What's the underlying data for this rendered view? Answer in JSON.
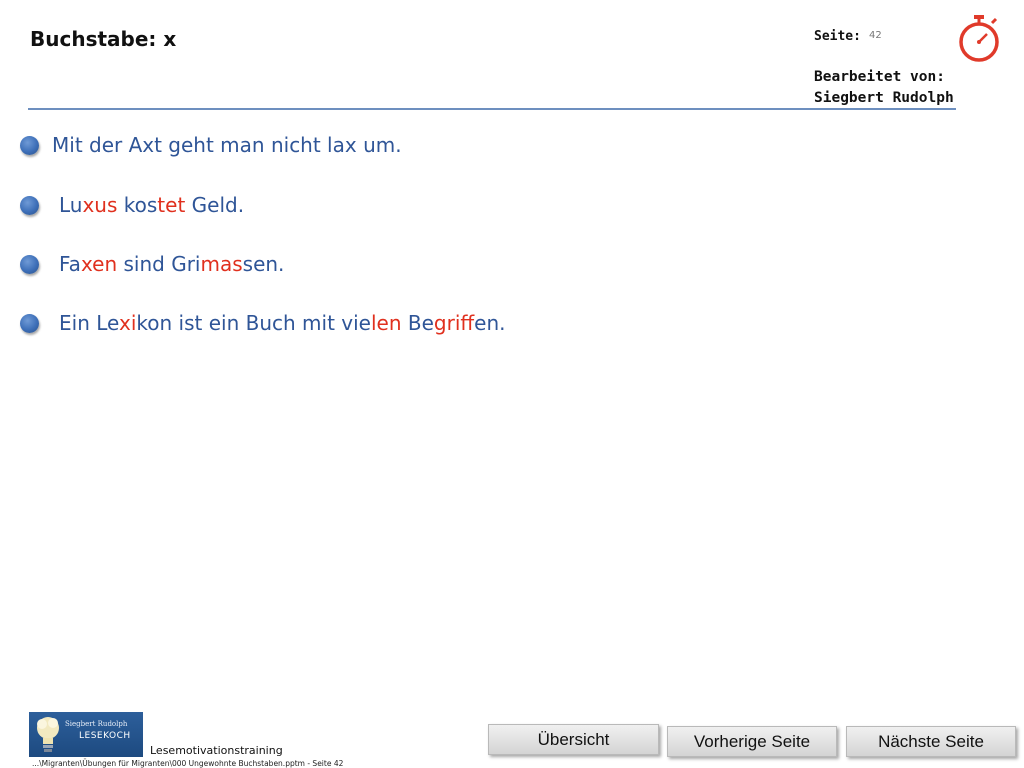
{
  "header": {
    "title": "Buchstabe: x",
    "page_label": "Seite:",
    "page_number": "42",
    "edited_by_label": "Bearbeitet von:",
    "edited_by_name": "Siegbert Rudolph"
  },
  "sentences": [
    [
      {
        "t": "Mit der Axt geht man nicht lax um.",
        "red": false
      }
    ],
    [
      {
        "t": "Lu",
        "red": false
      },
      {
        "t": "xus",
        "red": true
      },
      {
        "t": " kos",
        "red": false
      },
      {
        "t": "tet",
        "red": true
      },
      {
        "t": " Geld.",
        "red": false
      }
    ],
    [
      {
        "t": "Fa",
        "red": false
      },
      {
        "t": "xen",
        "red": true
      },
      {
        "t": " sind Gri",
        "red": false
      },
      {
        "t": "mas",
        "red": true
      },
      {
        "t": "sen.",
        "red": false
      }
    ],
    [
      {
        "t": "Ein Le",
        "red": false
      },
      {
        "t": "xi",
        "red": true
      },
      {
        "t": "kon ist ein Buch mit vie",
        "red": false
      },
      {
        "t": "len",
        "red": true
      },
      {
        "t": " Be",
        "red": false
      },
      {
        "t": "grif",
        "red": true
      },
      {
        "t": "fen.",
        "red": false
      }
    ]
  ],
  "logo": {
    "small_text": "Siegbert Rudolph",
    "name": "LESEKOCH"
  },
  "footer": {
    "training_label": "Lesemotivationstraining",
    "path": "...\\Migranten\\Übungen für Migranten\\000 Ungewohnte Buchstaben.pptm - Seite 42"
  },
  "buttons": {
    "overview": "Übersicht",
    "previous": "Vorherige Seite",
    "next": "Nächste Seite"
  },
  "colors": {
    "text_blue": "#2f5597",
    "highlight_red": "#e0301e",
    "rule_blue": "#6d8fbf",
    "timer_red": "#e03a2a"
  },
  "icons": {
    "timer": "stopwatch-icon",
    "bullet": "blue-circle-bullet-icon"
  }
}
